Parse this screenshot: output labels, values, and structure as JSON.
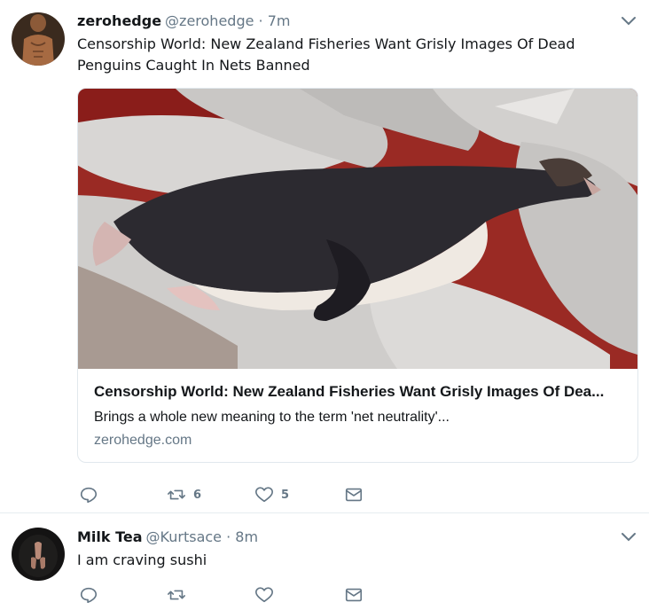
{
  "tweets": [
    {
      "name": "zerohedge",
      "handle": "@zerohedge",
      "separator": "·",
      "time": "7m",
      "text": "Censorship World: New Zealand Fisheries Want Grisly Images Of Dead Penguins Caught In Nets Banned",
      "card": {
        "title": "Censorship World: New Zealand Fisheries Want Grisly Images Of Dea...",
        "description": "Brings a whole new meaning to the term 'net neutrality'...",
        "domain": "zerohedge.com"
      },
      "actions": {
        "retweets": "6",
        "likes": "5"
      }
    },
    {
      "name": "Milk Tea",
      "handle": "@Kurtsace",
      "separator": "·",
      "time": "8m",
      "text": "I am craving sushi",
      "actions": {
        "retweets": "",
        "likes": ""
      }
    }
  ],
  "colors": {
    "text": "#14171a",
    "secondary": "#657786",
    "border": "#e6ecf0"
  },
  "icons": [
    "chevron-down-icon",
    "reply-icon",
    "retweet-icon",
    "heart-icon",
    "envelope-icon"
  ]
}
